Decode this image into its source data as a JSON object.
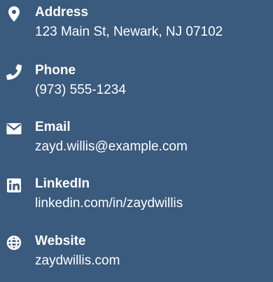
{
  "colors": {
    "background": "#3a5a7e",
    "text": "#ffffff"
  },
  "contacts": [
    {
      "icon": "map-marker-icon",
      "label": "Address",
      "value": "123 Main St, Newark, NJ 07102"
    },
    {
      "icon": "phone-icon",
      "label": "Phone",
      "value": "(973) 555-1234"
    },
    {
      "icon": "envelope-icon",
      "label": "Email",
      "value": "zayd.willis@example.com"
    },
    {
      "icon": "linkedin-icon",
      "label": "LinkedIn",
      "value": "linkedin.com/in/zaydwillis"
    },
    {
      "icon": "globe-icon",
      "label": "Website",
      "value": "zaydwillis.com"
    }
  ]
}
